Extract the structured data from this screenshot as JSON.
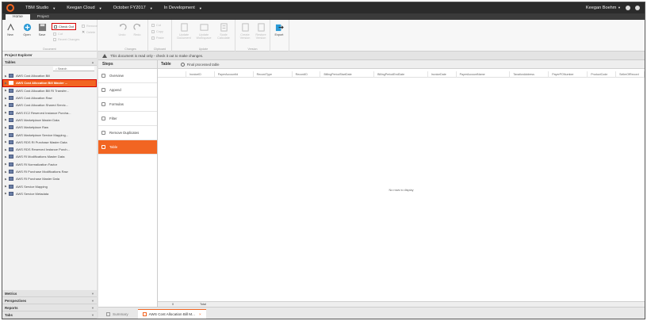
{
  "topbar": {
    "app": "TBM Studio",
    "model": "Keegan Cloud",
    "period": "October FY2017",
    "status": "In Development",
    "user": "Keegan Boehm"
  },
  "ribbon_tabs": [
    "Home",
    "Project"
  ],
  "ribbon": {
    "clipboard_group": {
      "new": "New",
      "save": "Save",
      "open": "Open",
      "check_out": "Check Out",
      "cut": "Cut",
      "revert_changes": "Revert Changes",
      "label": "Document"
    },
    "changes_group": {
      "undo": "Undo",
      "redo": "Redo",
      "label": "Changes"
    },
    "edit_group": {
      "remove": "Remove",
      "delete": "Delete",
      "label": ""
    },
    "clipboard2_group": {
      "cut": "Cut",
      "copy": "Copy",
      "paste": "Paste",
      "label": "Clipboard"
    },
    "update_group": {
      "update_document": "Update Document",
      "update_workspace": "Update Workspace",
      "scale_calculate": "Scale Calculate",
      "label": "Update"
    },
    "version_group": {
      "create_version": "Create Version",
      "restore_version": "Restore Version",
      "label": "Version"
    },
    "export_group": {
      "export": "Export",
      "label": ""
    }
  },
  "project_explorer": {
    "title": "Project Explorer",
    "tables_header": "Tables",
    "search_placeholder": "Search",
    "items": [
      "AWS Cost Allocation Bill",
      "AWS Cost Allocation Bill Master ...",
      "AWS Cost Allocation Bill RI Transfer...",
      "AWS Cost Allocation Raw",
      "AWS Cost Allocation Shared Servic...",
      "AWS EC2 Reserved Instance Purcha...",
      "AWS Marketplace Master Data",
      "AWS Marketplace Raw",
      "AWS Marketplace Service Mapping...",
      "AWS RDS RI Purchase Master Data",
      "AWS RDS Reserved Instance Purch...",
      "AWS RI Modifications Master Data",
      "AWS RI Normalization Factor",
      "AWS RI Purchase Modifications Raw",
      "AWS RI Purchase Master Data",
      "AWS Service Mapping",
      "AWS Service Metadata"
    ],
    "selected_index": 1,
    "bottom_sections": [
      "Metrics",
      "Perspectives",
      "Reports",
      "Tabs"
    ]
  },
  "infobar": {
    "message": "This document is read only - check it out to make changes."
  },
  "steps": {
    "title": "Steps",
    "items": [
      "Overview",
      "Append",
      "Formulas",
      "Filter",
      "Remove Duplicates",
      "Table"
    ],
    "active_index": 5
  },
  "table": {
    "title": "Table",
    "final_info": "Final processed table",
    "columns": [
      "InvoiceID",
      "PayerAccountId",
      "RecordType",
      "RecordID",
      "BillingPeriodStartDate",
      "BillingPeriodEndDate",
      "InvoiceDate",
      "PayerAccountName",
      "TaxationAddress",
      "PayerPONumber",
      "ProductCode",
      "SellerOfRecord"
    ],
    "empty_message": "No rows to display",
    "footer_count": "0",
    "footer_label": "Total"
  },
  "bottom_tabs": {
    "summary": "Summary",
    "active": "AWS Cost Allocation Bill M...",
    "close": "×"
  },
  "colors": {
    "accent": "#f26522",
    "highlight_border": "#d40000",
    "topbar": "#2b2b2b"
  }
}
